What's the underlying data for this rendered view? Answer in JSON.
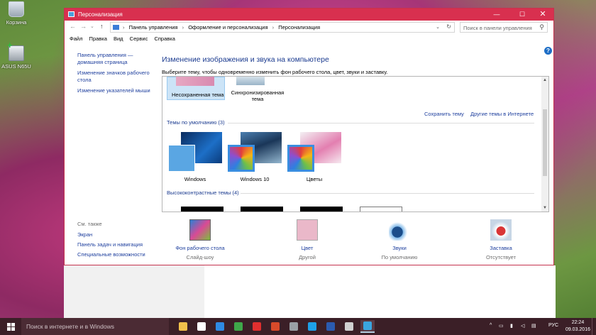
{
  "desktop": {
    "icons": [
      {
        "label": "Корзина"
      },
      {
        "label": "ASUS N65U"
      }
    ]
  },
  "window": {
    "title": "Персонализация",
    "controls": {
      "minimize": "—",
      "maximize": "☐",
      "close": "✕"
    },
    "nav": {
      "back": "←",
      "forward": "→",
      "recent": "⌄",
      "up": "↑"
    },
    "address": {
      "crumbs": [
        "Панель управления",
        "Оформление и персонализация",
        "Персонализация"
      ],
      "separator": "›",
      "dropdown": "⌄",
      "refresh": "↻"
    },
    "search_placeholder": "Поиск в панели управления",
    "menu": [
      "Файл",
      "Правка",
      "Вид",
      "Сервис",
      "Справка"
    ],
    "help": "?"
  },
  "left_pane": {
    "links": [
      "Панель управления — домашняя страница",
      "Изменение значков рабочего стола",
      "Изменение указателей мыши"
    ],
    "see_also_header": "См. также",
    "see_also": [
      "Экран",
      "Панель задач и навигация",
      "Специальные возможности"
    ]
  },
  "main": {
    "heading": "Изменение изображения и звука на компьютере",
    "subheading": "Выберите тему, чтобы одновременно изменить фон рабочего стола, цвет, звуки и заставку.",
    "my_themes": [
      "Несохраненная тема",
      "Синхронизированная тема"
    ],
    "save_theme": "Сохранить тему",
    "more_themes": "Другие темы в Интернете",
    "default_group": "Темы по умолчанию (3)",
    "default_themes": [
      "Windows",
      "Windows 10",
      "Цветы"
    ],
    "hc_group": "Высококонтрастные темы (4)",
    "scroll": {
      "up": "▲",
      "down": "▼"
    }
  },
  "bottom": [
    {
      "label": "Фон рабочего стола",
      "sub": "Слайд-шоу",
      "icon": "wallpaper-icon"
    },
    {
      "label": "Цвет",
      "sub": "Другой",
      "icon": "color-icon"
    },
    {
      "label": "Звуки",
      "sub": "По умолчанию",
      "icon": "sounds-icon"
    },
    {
      "label": "Заставка",
      "sub": "Отсутствует",
      "icon": "screensaver-icon"
    }
  ],
  "taskbar": {
    "search_placeholder": "Поиск в интернете и в Windows",
    "lang": "РУС",
    "time": "22:24",
    "date": "09.03.2016",
    "tray_arrow": "^",
    "apps": [
      {
        "name": "explorer",
        "color": "#f2c14b"
      },
      {
        "name": "store",
        "color": "#ffffff"
      },
      {
        "name": "edge",
        "color": "#2f8ae3"
      },
      {
        "name": "chrome",
        "color": "#3fa84a"
      },
      {
        "name": "yandex",
        "color": "#e02f2f"
      },
      {
        "name": "antivirus",
        "color": "#d84a2a"
      },
      {
        "name": "media",
        "color": "#9aa0a6"
      },
      {
        "name": "skype",
        "color": "#1ea0e8"
      },
      {
        "name": "word",
        "color": "#2b5bb0"
      },
      {
        "name": "settings",
        "color": "#d0d0d0"
      },
      {
        "name": "personalization",
        "color": "#3aa5e0"
      }
    ]
  }
}
